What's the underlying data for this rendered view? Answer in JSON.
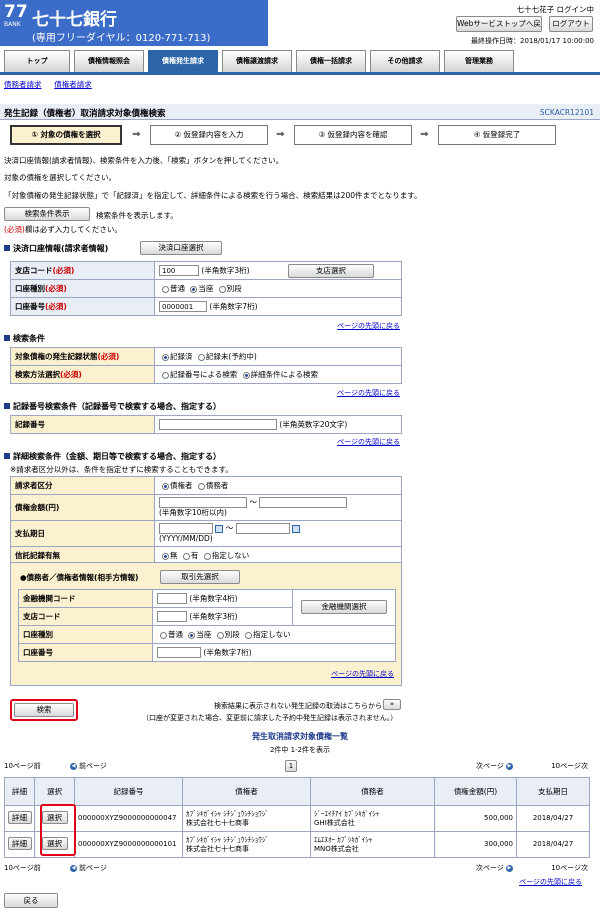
{
  "header": {
    "bank_logo_number": "77",
    "bank_logo_sub": "BANK",
    "bank_name": "七十七銀行",
    "free_dial": "(専用フリーダイヤル：0120-771-713)",
    "user_status": "七十七花子 ログイン中",
    "web_top_button": "Webサービストップへ戻る",
    "logout_button": "ログアウト",
    "last_operation": "最終操作日時：2018/01/17 10:00:00",
    "brand_color": "#3b6cc8"
  },
  "tabs": [
    {
      "label": "トップ"
    },
    {
      "label": "債権情報照会"
    },
    {
      "label": "債権発生請求"
    },
    {
      "label": "債権譲渡請求"
    },
    {
      "label": "債権一括請求"
    },
    {
      "label": "その他請求"
    },
    {
      "label": "管理業務"
    }
  ],
  "subnav": {
    "item1": "債務者請求",
    "item2": "債権者請求"
  },
  "page": {
    "title": "発生記録（債権者）取消請求対象債権検索",
    "code": "SCKACR12101"
  },
  "steps": [
    {
      "label": "① 対象の債権を選択"
    },
    {
      "label": "② 仮登録内容を入力"
    },
    {
      "label": "③ 仮登録内容を確認"
    },
    {
      "label": "④ 仮登録完了"
    }
  ],
  "instructions": {
    "line1": "決済口座情報(請求者情報)、検索条件を入力後、「検索」ボタンを押してください。",
    "line2": "対象の債権を選択してください。",
    "line3": "「対象債権の発生記録状態」で「記録済」を指定して、詳細条件による検索を行う場合、検索結果は200件までとなります。",
    "toggle_button": "検索条件表示",
    "toggle_note": "検索条件を表示します。",
    "required_mark": "(必須)",
    "required_note": "欄は必ず入力してください。"
  },
  "account_section": {
    "title": "決済口座情報(請求者情報)",
    "select_button": "決済口座選択",
    "branch_label": "支店コード",
    "branch_value": "100",
    "branch_hint": "(半角数字3桁)",
    "branch_button": "支店選択",
    "type_label": "口座種別",
    "type_options": [
      "普通",
      "当座",
      "別段"
    ],
    "number_label": "口座番号",
    "number_value": "0000001",
    "number_hint": "(半角数字7桁)",
    "to_top": "ページの先頭に戻る"
  },
  "search_section": {
    "title": "検索条件",
    "status_label": "対象債権の発生記録状態",
    "status_options": [
      "記録済",
      "記録未(予約中)"
    ],
    "method_label": "検索方法選択",
    "method_options": [
      "記録番号による検索",
      "詳細条件による検索"
    ],
    "to_top": "ページの先頭に戻る"
  },
  "record_section": {
    "title": "記録番号検索条件（記録番号で検索する場合、指定する）",
    "record_label": "記録番号",
    "record_hint": "(半角英数字20文字)",
    "to_top": "ページの先頭に戻る"
  },
  "detail_section": {
    "title": "詳細検索条件（金額、期日等で検索する場合、指定する）",
    "note": "※請求者区分以外は、条件を指定せずに検索することもできます。",
    "party_label": "請求者区分",
    "party_options": [
      "債権者",
      "債務者"
    ],
    "amount_label": "債権金額(円)",
    "amount_hint": "(半角数字10桁以内)",
    "range_sep": "～",
    "due_label": "支払期日",
    "date_hint": "(YYYY/MM/DD)",
    "trust_label": "信託記録有無",
    "trust_options": [
      "無",
      "有",
      "指定しない"
    ],
    "counterparty_title": "●債務者／債権者情報(相手方情報)",
    "counterparty_button": "取引先選択",
    "fin_code_label": "金融機関コード",
    "fin_code_hint": "(半角数字4桁)",
    "fin_button": "金融機関選択",
    "cp_branch_label": "支店コード",
    "cp_branch_hint": "(半角数字3桁)",
    "cp_type_label": "口座種別",
    "cp_type_options": [
      "普通",
      "当座",
      "別段",
      "指定しない"
    ],
    "cp_number_label": "口座番号",
    "cp_number_hint": "(半角数字7桁)",
    "inner_to_top": "ページの先頭に戻る"
  },
  "search_button": "検索",
  "unlisted_note1": "検索結果に表示されない発生記録の取消はこちらから",
  "unlisted_note2": "（口座が変更された場合、変更前に請求した予約中発生記録は表示されません。）",
  "results": {
    "title": "発生取消請求対象債権一覧",
    "count": "2件中 1-2件を表示",
    "prev10": "10ページ前",
    "prev": "前ページ",
    "page": "1",
    "next": "次ページ",
    "next10": "10ページ次",
    "columns": [
      "詳細",
      "選択",
      "記録番号",
      "債権者",
      "債務者",
      "債権金額(円)",
      "支払期日"
    ],
    "detail_button": "詳細",
    "select_button": "選択",
    "rows": [
      {
        "record": "000000XYZ9000000000047",
        "creditor_kana": "ｶﾌﾞｼｷｶﾞｲｼｬ ｼﾁｼﾞｭｳｼﾁｼｮｳｼﾞ",
        "creditor": "株式会社七十七商事",
        "debtor_kana": "ｼﾞｰｴｲﾁｱｲ ｶﾌﾞｼｷｶﾞｲｼｬ",
        "debtor": "GHI株式会社",
        "amount": "500,000",
        "due": "2018/04/27"
      },
      {
        "record": "000000XYZ9000000000101",
        "creditor_kana": "ｶﾌﾞｼｷｶﾞｲｼｬ ｼﾁｼﾞｭｳｼﾁｼｮｳｼﾞ",
        "creditor": "株式会社七十七商事",
        "debtor_kana": "ｴﾑｴﾇｵｰ ｶﾌﾞｼｷｶﾞｲｼｬ",
        "debtor": "MNO株式会社",
        "amount": "300,000",
        "due": "2018/04/27"
      }
    ],
    "to_top": "ページの先頭に戻る"
  },
  "back_button": "戻る"
}
